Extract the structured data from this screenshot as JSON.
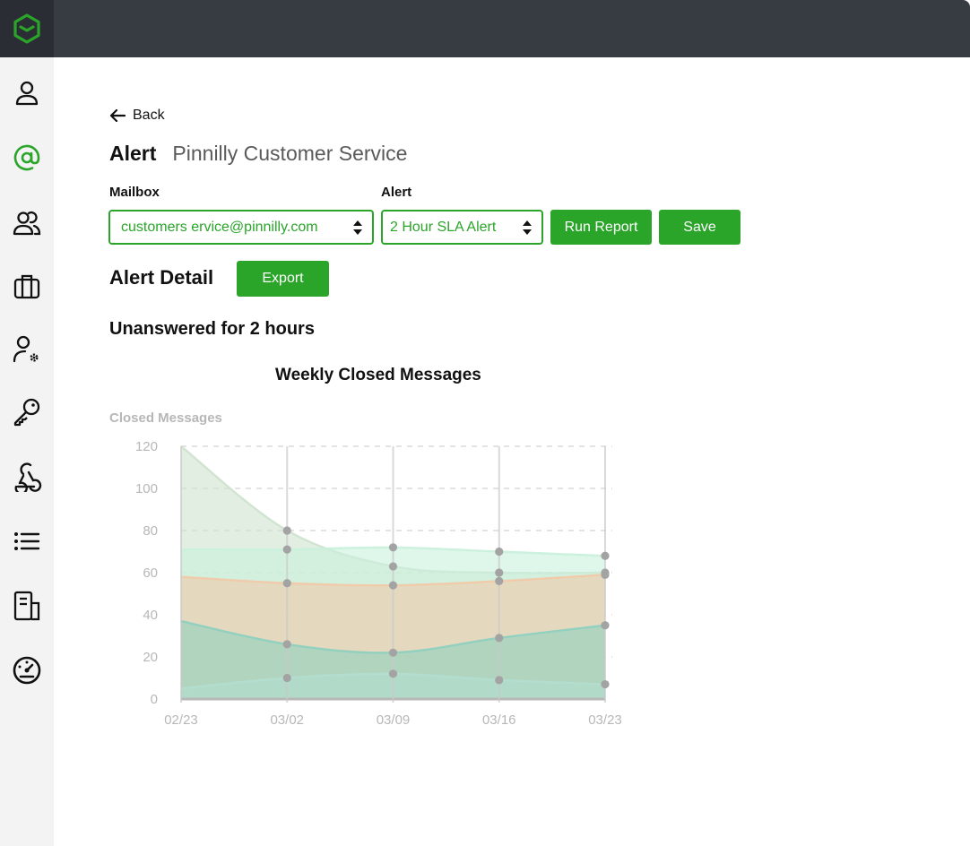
{
  "nav": {
    "items": [
      {
        "icon": "user-icon",
        "active": false
      },
      {
        "icon": "at-sign-icon",
        "active": true
      },
      {
        "icon": "users-icon",
        "active": false
      },
      {
        "icon": "briefcase-icon",
        "active": false
      },
      {
        "icon": "user-settings-icon",
        "active": false
      },
      {
        "icon": "key-icon",
        "active": false
      },
      {
        "icon": "webhook-icon",
        "active": false
      },
      {
        "icon": "list-icon",
        "active": false
      },
      {
        "icon": "document-icon",
        "active": false
      },
      {
        "icon": "dashboard-icon",
        "active": false
      }
    ]
  },
  "back_label": "Back",
  "header": {
    "title": "Alert",
    "subtitle": "Pinnilly Customer Service"
  },
  "filters": {
    "mailbox_label": "Mailbox",
    "mailbox_value": "customers ervice@pinnilly.com",
    "alert_label": "Alert",
    "alert_value": "2 Hour SLA Alert",
    "run_report_label": "Run Report",
    "save_label": "Save"
  },
  "detail": {
    "heading": "Alert Detail",
    "export_label": "Export",
    "subheading": "Unanswered for 2 hours"
  },
  "colors": {
    "accent": "#2aa52a",
    "topbar": "#373b42"
  },
  "chart_data": {
    "type": "area",
    "title": "Weekly Closed Messages",
    "ylabel": "Closed Messages",
    "xlabel": "",
    "x": [
      "02/23",
      "03/02",
      "03/09",
      "03/16",
      "03/23"
    ],
    "y_ticks": [
      0,
      20,
      40,
      60,
      80,
      100,
      120
    ],
    "ylim": [
      0,
      120
    ],
    "grid": true,
    "series": [
      {
        "values": [
          120,
          80,
          63,
          60,
          60
        ],
        "color": "#cfe3cf"
      },
      {
        "values": [
          71,
          71,
          72,
          70,
          68
        ],
        "color": "#c9f0dc"
      },
      {
        "values": [
          58,
          55,
          54,
          56,
          59
        ],
        "color": "#f0c9a8"
      },
      {
        "values": [
          37,
          26,
          22,
          29,
          35
        ],
        "color": "#8fd0bf"
      },
      {
        "values": [
          5,
          10,
          12,
          9,
          7
        ],
        "color": "#b3ddd0"
      }
    ]
  }
}
